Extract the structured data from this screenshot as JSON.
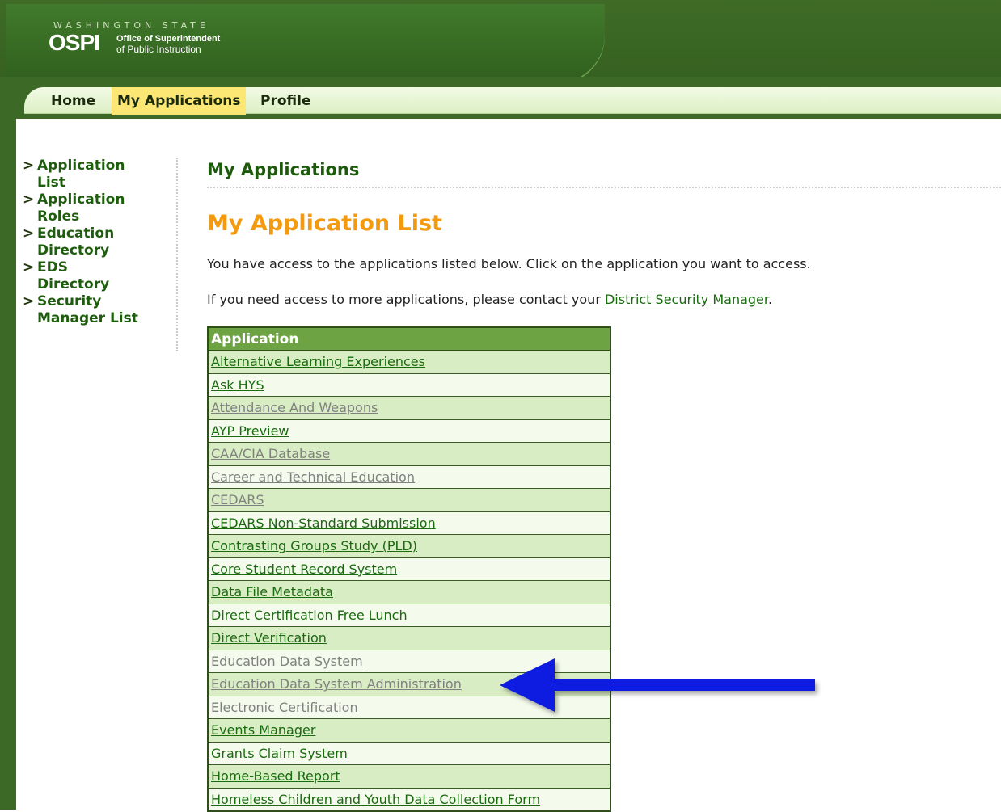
{
  "header": {
    "state_text": "WASHINGTON STATE",
    "logo_text": "OSPI",
    "org_line1": "Office of Superintendent",
    "org_line2": "of Public Instruction"
  },
  "nav": {
    "home": "Home",
    "my_applications": "My Applications",
    "profile": "Profile",
    "active_tab": "My Applications",
    "active_color": "#fce774"
  },
  "sidebar": {
    "arrow_glyph": ">",
    "items": [
      {
        "label": "Application List"
      },
      {
        "label": "Application Roles"
      },
      {
        "label": "Education Directory"
      },
      {
        "label": "EDS Directory"
      },
      {
        "label": "Security Manager List"
      }
    ]
  },
  "main": {
    "page_title": "My Applications",
    "subtitle": "My Application List",
    "intro": "You have access to the applications listed below. Click on the application you want to access.",
    "contact_prefix": "If you need access to more applications, please contact your ",
    "contact_link": "District Security Manager",
    "contact_suffix": "."
  },
  "table": {
    "header": "Application",
    "rows": [
      {
        "label": "Alternative Learning Experiences",
        "enabled": true
      },
      {
        "label": "Ask HYS",
        "enabled": true
      },
      {
        "label": "Attendance And Weapons",
        "enabled": false
      },
      {
        "label": "AYP Preview",
        "enabled": true
      },
      {
        "label": "CAA/CIA Database",
        "enabled": false
      },
      {
        "label": "Career and Technical Education",
        "enabled": false
      },
      {
        "label": "CEDARS",
        "enabled": false
      },
      {
        "label": "CEDARS Non-Standard Submission",
        "enabled": true
      },
      {
        "label": "Contrasting Groups Study (PLD)",
        "enabled": true
      },
      {
        "label": "Core Student Record System",
        "enabled": true
      },
      {
        "label": "Data File Metadata",
        "enabled": true
      },
      {
        "label": "Direct Certification Free Lunch",
        "enabled": true
      },
      {
        "label": "Direct Verification",
        "enabled": true
      },
      {
        "label": "Education Data System",
        "enabled": false
      },
      {
        "label": "Education Data System Administration",
        "enabled": false
      },
      {
        "label": "Electronic Certification",
        "enabled": false
      },
      {
        "label": "Events Manager",
        "enabled": true
      },
      {
        "label": "Grants Claim System",
        "enabled": true
      },
      {
        "label": "Home-Based Report",
        "enabled": true
      },
      {
        "label": "Homeless Children and Youth Data Collection Form",
        "enabled": true
      }
    ]
  },
  "annotation": {
    "icon": "arrow-left-icon",
    "color": "#0a1fe0",
    "points_to": "Education Data System Administration"
  }
}
